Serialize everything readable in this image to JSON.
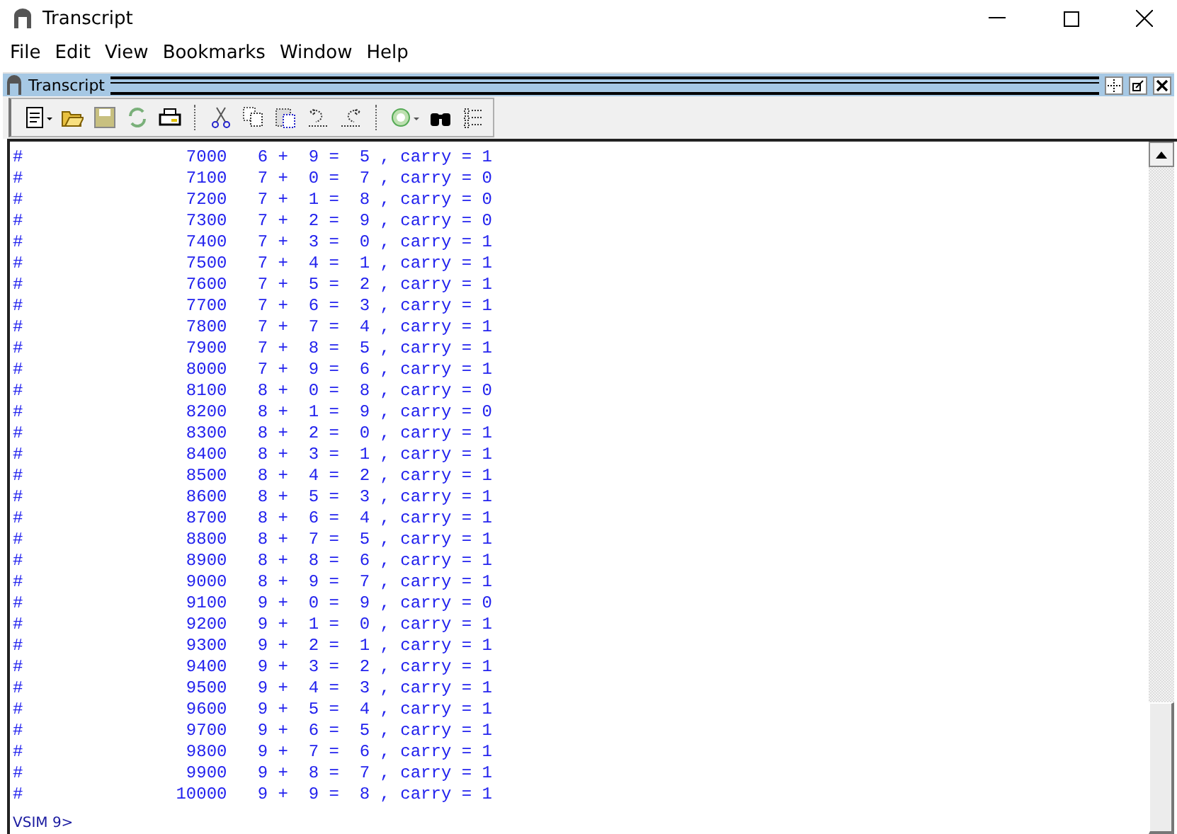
{
  "window": {
    "title": "Transcript"
  },
  "menu": [
    "File",
    "Edit",
    "View",
    "Bookmarks",
    "Window",
    "Help"
  ],
  "panel": {
    "title": "Transcript"
  },
  "lines": [
    "#                7000   6 +  9 =  5 , carry = 1",
    "#                7100   7 +  0 =  7 , carry = 0",
    "#                7200   7 +  1 =  8 , carry = 0",
    "#                7300   7 +  2 =  9 , carry = 0",
    "#                7400   7 +  3 =  0 , carry = 1",
    "#                7500   7 +  4 =  1 , carry = 1",
    "#                7600   7 +  5 =  2 , carry = 1",
    "#                7700   7 +  6 =  3 , carry = 1",
    "#                7800   7 +  7 =  4 , carry = 1",
    "#                7900   7 +  8 =  5 , carry = 1",
    "#                8000   7 +  9 =  6 , carry = 1",
    "#                8100   8 +  0 =  8 , carry = 0",
    "#                8200   8 +  1 =  9 , carry = 0",
    "#                8300   8 +  2 =  0 , carry = 1",
    "#                8400   8 +  3 =  1 , carry = 1",
    "#                8500   8 +  4 =  2 , carry = 1",
    "#                8600   8 +  5 =  3 , carry = 1",
    "#                8700   8 +  6 =  4 , carry = 1",
    "#                8800   8 +  7 =  5 , carry = 1",
    "#                8900   8 +  8 =  6 , carry = 1",
    "#                9000   8 +  9 =  7 , carry = 1",
    "#                9100   9 +  0 =  9 , carry = 0",
    "#                9200   9 +  1 =  0 , carry = 1",
    "#                9300   9 +  2 =  1 , carry = 1",
    "#                9400   9 +  3 =  2 , carry = 1",
    "#                9500   9 +  4 =  3 , carry = 1",
    "#                9600   9 +  5 =  4 , carry = 1",
    "#                9700   9 +  6 =  5 , carry = 1",
    "#                9800   9 +  7 =  6 , carry = 1",
    "#                9900   9 +  8 =  7 , carry = 1",
    "#               10000   9 +  9 =  8 , carry = 1"
  ],
  "prompt": "VSIM 9>"
}
